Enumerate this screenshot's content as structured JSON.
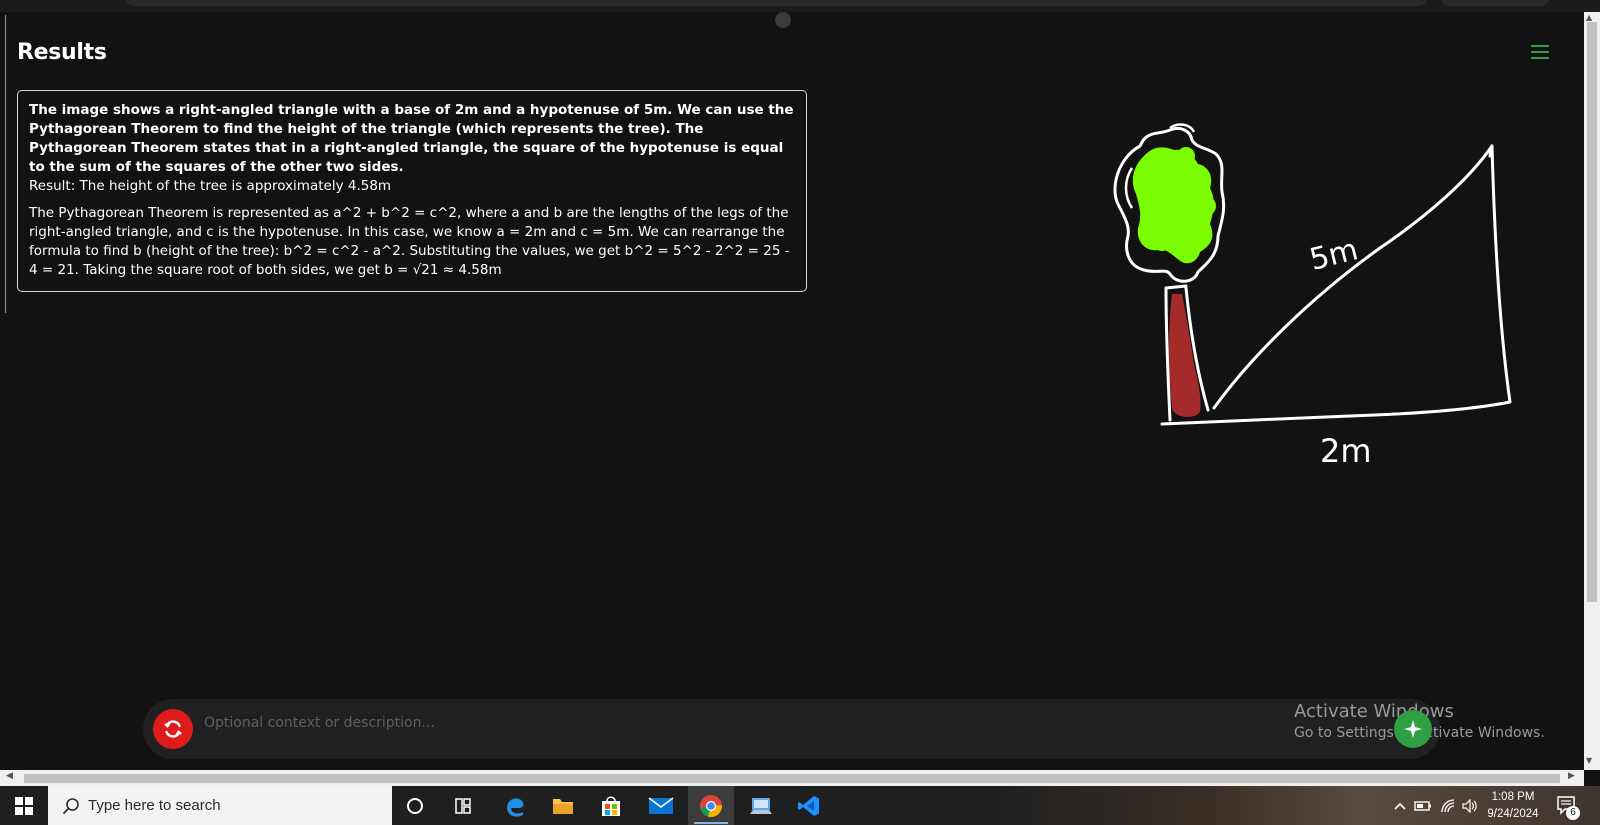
{
  "header": {
    "title": "Results",
    "menu_icon": "hamburger-menu-icon"
  },
  "result": {
    "analysis": "The image shows a right-angled triangle with a base of 2m and a hypotenuse of 5m. We can use the Pythagorean Theorem to find the height of the triangle (which represents the tree). The Pythagorean Theorem states that in a right-angled triangle, the square of the hypotenuse is equal to the sum of the squares of the other two sides.",
    "result_line": "Result: The height of the tree is approximately 4.58m",
    "explanation": "The Pythagorean Theorem is represented as a^2 + b^2 = c^2, where a and b are the lengths of the legs of the right-angled triangle, and c is the hypotenuse. In this case, we know a = 2m and c = 5m. We can rearrange the formula to find b (height of the tree): b^2 = c^2 - a^2. Substituting the values, we get b^2 = 5^2 - 2^2 = 25 - 4 = 21. Taking the square root of both sides, we get b = √21 ≈ 4.58m"
  },
  "drawing": {
    "hypotenuse_label": "5m",
    "base_label": "2m",
    "colors": {
      "foliage": "#7cfc00",
      "trunk": "#a52a2a",
      "stroke": "#ffffff"
    }
  },
  "input": {
    "placeholder": "Optional context or description...",
    "reset_icon": "refresh-icon",
    "send_icon": "sparkle-icon",
    "reset_color": "#e01b1b",
    "send_color": "#2ea043"
  },
  "watermark": {
    "title": "Activate Windows",
    "subtitle": "Go to Settings to activate Windows."
  },
  "taskbar": {
    "search_placeholder": "Type here to search",
    "apps": [
      "cortana-icon",
      "task-view-icon",
      "edge-icon",
      "file-explorer-icon",
      "microsoft-store-icon",
      "mail-icon",
      "chrome-icon",
      "remote-desktop-icon",
      "vscode-icon"
    ],
    "clock_time": "1:08 PM",
    "clock_date": "9/24/2024",
    "notification_count": "6"
  }
}
